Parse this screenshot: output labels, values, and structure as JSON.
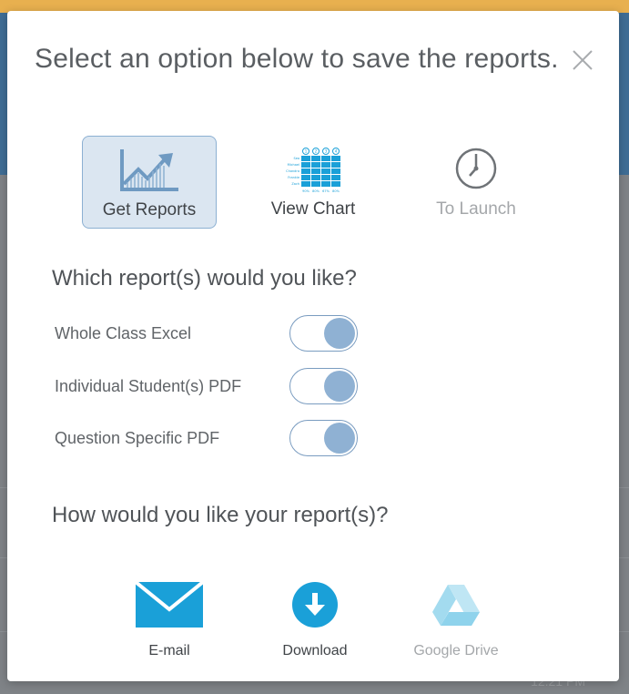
{
  "background": {
    "clock_text": "12:21 PM"
  },
  "dialog": {
    "title": "Select an option below to save the reports.",
    "close_icon": "close-icon"
  },
  "tabs": [
    {
      "label": "Get Reports",
      "icon": "trend-chart-icon",
      "state": "selected"
    },
    {
      "label": "View Chart",
      "icon": "grid-chart-icon",
      "state": "normal"
    },
    {
      "label": "To Launch",
      "icon": "clock-icon",
      "state": "disabled"
    }
  ],
  "reports": {
    "heading": "Which report(s) would you like?",
    "options": [
      {
        "label": "Whole Class Excel",
        "enabled": true
      },
      {
        "label": "Individual Student(s) PDF",
        "enabled": true
      },
      {
        "label": "Question Specific PDF",
        "enabled": true
      }
    ]
  },
  "delivery": {
    "heading": "How would you like your report(s)?",
    "options": [
      {
        "label": "E-mail",
        "icon": "envelope-icon",
        "state": "normal"
      },
      {
        "label": "Download",
        "icon": "download-icon",
        "state": "normal"
      },
      {
        "label": "Google Drive",
        "icon": "google-drive-icon",
        "state": "disabled"
      }
    ]
  },
  "colors": {
    "accent_blue": "#1aa0d8",
    "selected_tab_bg": "#dbe6f1",
    "toggle_knob": "#8fb1d3",
    "disabled_text": "#a4a7aa"
  },
  "chart_icon_text": {
    "names": [
      "Sea",
      "Michael",
      "Chandra",
      "Frankie",
      "Zach"
    ],
    "columns": [
      "1",
      "2",
      "3",
      "4"
    ],
    "footer": [
      "90%",
      "80%",
      "67%",
      "80%"
    ]
  }
}
